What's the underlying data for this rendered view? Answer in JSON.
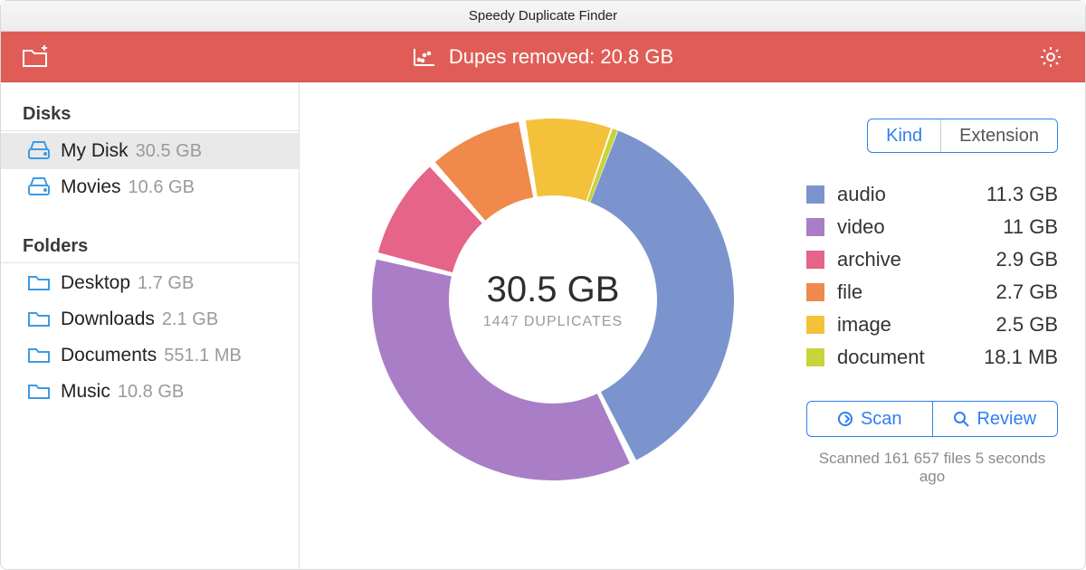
{
  "window": {
    "title": "Speedy Duplicate Finder"
  },
  "toolbar": {
    "status_prefix": "Dupes removed: ",
    "status_value": "20.8 GB"
  },
  "sidebar": {
    "disks_heading": "Disks",
    "folders_heading": "Folders",
    "disks": [
      {
        "label": "My Disk",
        "size": "30.5 GB",
        "selected": true
      },
      {
        "label": "Movies",
        "size": "10.6 GB",
        "selected": false
      }
    ],
    "folders": [
      {
        "label": "Desktop",
        "size": "1.7 GB"
      },
      {
        "label": "Downloads",
        "size": "2.1 GB"
      },
      {
        "label": "Documents",
        "size": "551.1 MB"
      },
      {
        "label": "Music",
        "size": "10.8 GB"
      }
    ]
  },
  "center": {
    "total_size": "30.5 GB",
    "count_label": "1447 DUPLICATES"
  },
  "segmented": {
    "kind": "Kind",
    "extension": "Extension",
    "active": "kind"
  },
  "actions": {
    "scan": "Scan",
    "review": "Review"
  },
  "status_line": "Scanned 161 657 files 5 seconds ago",
  "colors": {
    "audio": "#7b94cd",
    "video": "#a97ec6",
    "archive": "#e56487",
    "file": "#f08a4c",
    "image": "#f3c23a",
    "document": "#c9d33a"
  },
  "chart_data": {
    "type": "pie",
    "title": "Duplicate size by kind",
    "total_label": "30.5 GB",
    "unit": "GB",
    "series": [
      {
        "name": "audio",
        "value": 11.3,
        "display": "11.3 GB",
        "color": "#7b94cd"
      },
      {
        "name": "video",
        "value": 11.0,
        "display": "11 GB",
        "color": "#a97ec6"
      },
      {
        "name": "archive",
        "value": 2.9,
        "display": "2.9 GB",
        "color": "#e56487"
      },
      {
        "name": "file",
        "value": 2.7,
        "display": "2.7 GB",
        "color": "#f08a4c"
      },
      {
        "name": "image",
        "value": 2.5,
        "display": "2.5 GB",
        "color": "#f3c23a"
      },
      {
        "name": "document",
        "value": 0.0177,
        "display": "18.1 MB",
        "color": "#c9d33a"
      }
    ]
  }
}
